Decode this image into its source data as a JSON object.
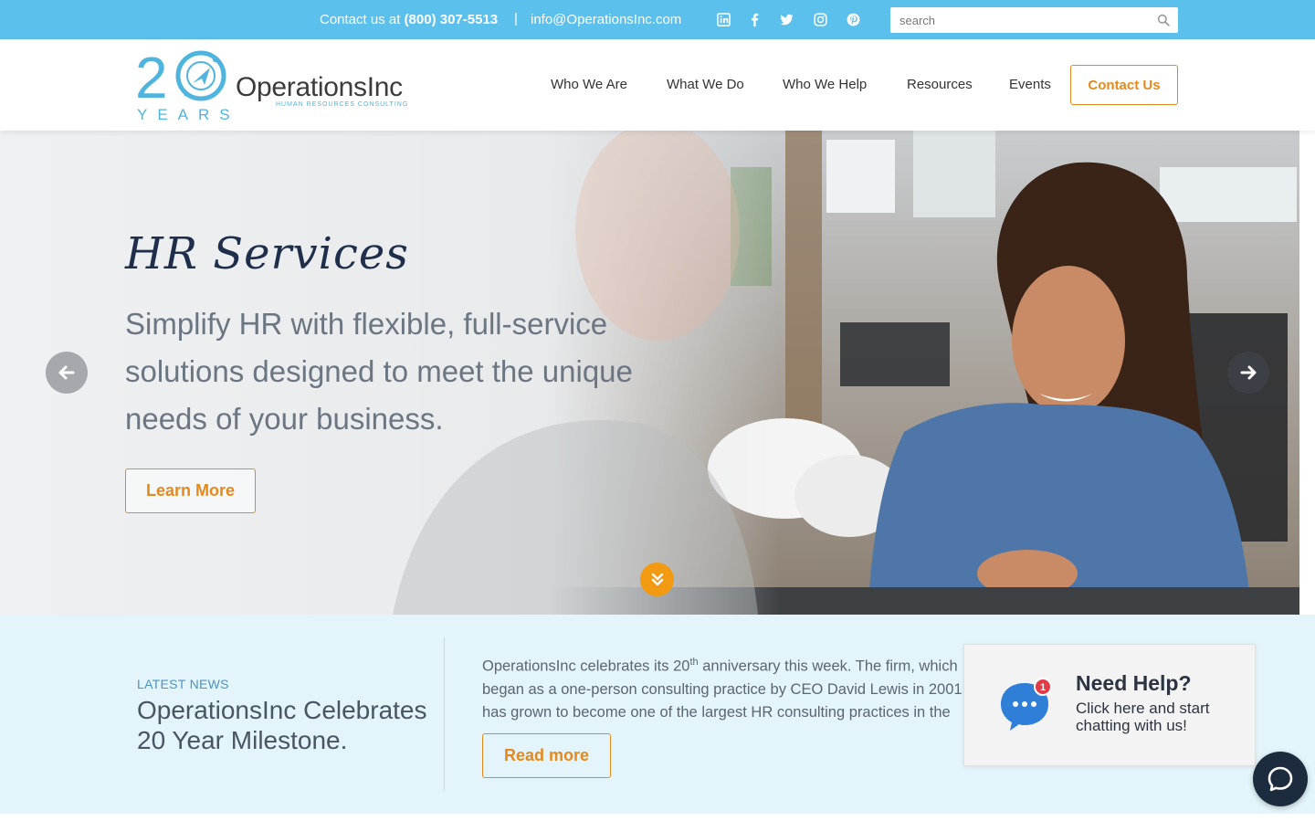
{
  "topbar": {
    "contact_prefix": "Contact us at",
    "phone": "(800) 307-5513",
    "separator": "|",
    "email": "info@OperationsInc.com",
    "social_icons": [
      "linkedin-icon",
      "facebook-icon",
      "twitter-icon",
      "instagram-icon",
      "pinterest-icon"
    ],
    "search_placeholder": "search"
  },
  "logo": {
    "number": "20",
    "years": "YEARS",
    "name": "OperationsInc",
    "tagline": "HUMAN RESOURCES CONSULTING"
  },
  "nav": {
    "items": [
      "Who We Are",
      "What We Do",
      "Who We Help",
      "Resources",
      "Events"
    ],
    "cta": "Contact Us"
  },
  "hero": {
    "title": "HR Services",
    "text": "Simplify HR with flexible, full-service solutions designed to meet the unique needs of your business.",
    "button": "Learn More"
  },
  "news": {
    "label": "LATEST NEWS",
    "headline": "OperationsInc Celebrates 20 Year Milestone.",
    "body_part1": "OperationsInc celebrates its 20",
    "body_sup": "th",
    "body_part2": " anniversary this week. The firm, which began as a one-person consulting practice by CEO David Lewis in 2001, has grown to become one of the largest HR consulting practices in the U.S.",
    "button": "Read more"
  },
  "chat": {
    "badge": "1",
    "title": "Need Help?",
    "subtitle": "Click here and start chatting with us!"
  },
  "colors": {
    "topbar": "#5bc0eb",
    "accent_orange": "#e48a1c",
    "navy": "#1f2f4b",
    "news_bg": "#e3f4fb"
  }
}
